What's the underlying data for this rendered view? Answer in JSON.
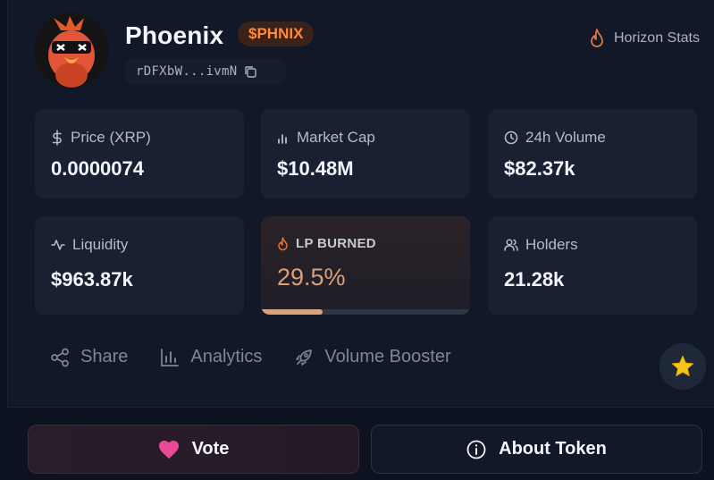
{
  "token": {
    "name": "Phoenix",
    "ticker": "$PHNIX",
    "address": "rDFXbW...ivmN"
  },
  "provider": {
    "label": "Horizon Stats",
    "icon": "flame-icon"
  },
  "stats": {
    "price": {
      "label": "Price (XRP)",
      "value": "0.0000074",
      "icon": "dollar-icon"
    },
    "market_cap": {
      "label": "Market Cap",
      "value": "$10.48M",
      "icon": "bar-chart-icon"
    },
    "volume": {
      "label": "24h Volume",
      "value": "$82.37k",
      "icon": "clock-icon"
    },
    "liquidity": {
      "label": "Liquidity",
      "value": "$963.87k",
      "icon": "activity-icon"
    },
    "lp_burned": {
      "label": "LP BURNED",
      "value": "29.5%",
      "percent": 29.5,
      "icon": "flame-icon"
    },
    "holders": {
      "label": "Holders",
      "value": "21.28k",
      "icon": "users-icon"
    }
  },
  "actions": {
    "share": "Share",
    "analytics": "Analytics",
    "volume_booster": "Volume Booster"
  },
  "buttons": {
    "vote": "Vote",
    "about": "About Token"
  },
  "colors": {
    "accent_orange": "#ff8a3d",
    "lp_burned": "#d9a07c",
    "heart": "#ec4899",
    "star": "#f5c518"
  }
}
